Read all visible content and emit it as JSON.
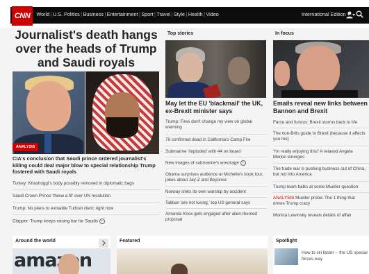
{
  "brand": {
    "logo_text": "CNN",
    "accent": "#cc0000"
  },
  "nav": {
    "items": [
      "World",
      "U.S. Politics",
      "Business",
      "Entertainment",
      "Sport",
      "Travel",
      "Style",
      "Health",
      "Video"
    ],
    "edition": "International Edition +"
  },
  "lead": {
    "headline": "Journalist's death hangs over the heads of Trump and Saudi royals",
    "badge": "ANALYSIS",
    "caption": "CIA's conclusion that Saudi prince ordered journalist's killing could deal major blow to special relationship Trump fostered with Saudi royals",
    "links": [
      "Turkey: Khashoggi's body possibly removed in diplomatic bags",
      "Saudi Crown Prince 'threw a fit' over UN resolution",
      "Trump: No plans to extradite Turkish cleric right now",
      "Clapper: Trump keeps raising bar for Saudis"
    ]
  },
  "top_stories": {
    "label": "Top stories",
    "title": "May let the EU 'blackmail' the UK, ex-Brexit minister says",
    "links": [
      "Trump: Fires don't change my view on global warming",
      "76 confirmed dead in California's Camp Fire",
      "Submarine 'imploded' with 44 on board",
      "New images of submarine's wreckage",
      "Obama surprises audience at Michelle's book tour, jokes about Jay-Z and Beyonce",
      "Norway sinks its own warship by accident",
      "Taliban 'are not losing,' top US general says",
      "Amanda Knox gets engaged after alien-themed proposal"
    ]
  },
  "in_focus": {
    "label": "In focus",
    "title": "Emails reveal new links between Bannon and Brexit",
    "links": [
      "Farce and furious: Brexit storms back to life",
      "The non-Brits guide to Brexit (because it affects you too)",
      "'I'm really enjoying this!' A relaxed Angela Merkel emerges",
      "The trade war is pushing business out of China, but not into America",
      "Trump team balks at some Mueller question",
      "Mueller probe: The 1 thing that drives Trump crazy",
      "Monica Lewinsky reveals details of affair"
    ],
    "analysis_prefix": "ANALYSIS"
  },
  "bottom": {
    "around_label": "Around the world",
    "featured_label": "Featured",
    "spotlight_label": "Spotlight",
    "spotlight_text": "How to ski faster -- the US special forces way",
    "amazon_text": "amazon"
  }
}
